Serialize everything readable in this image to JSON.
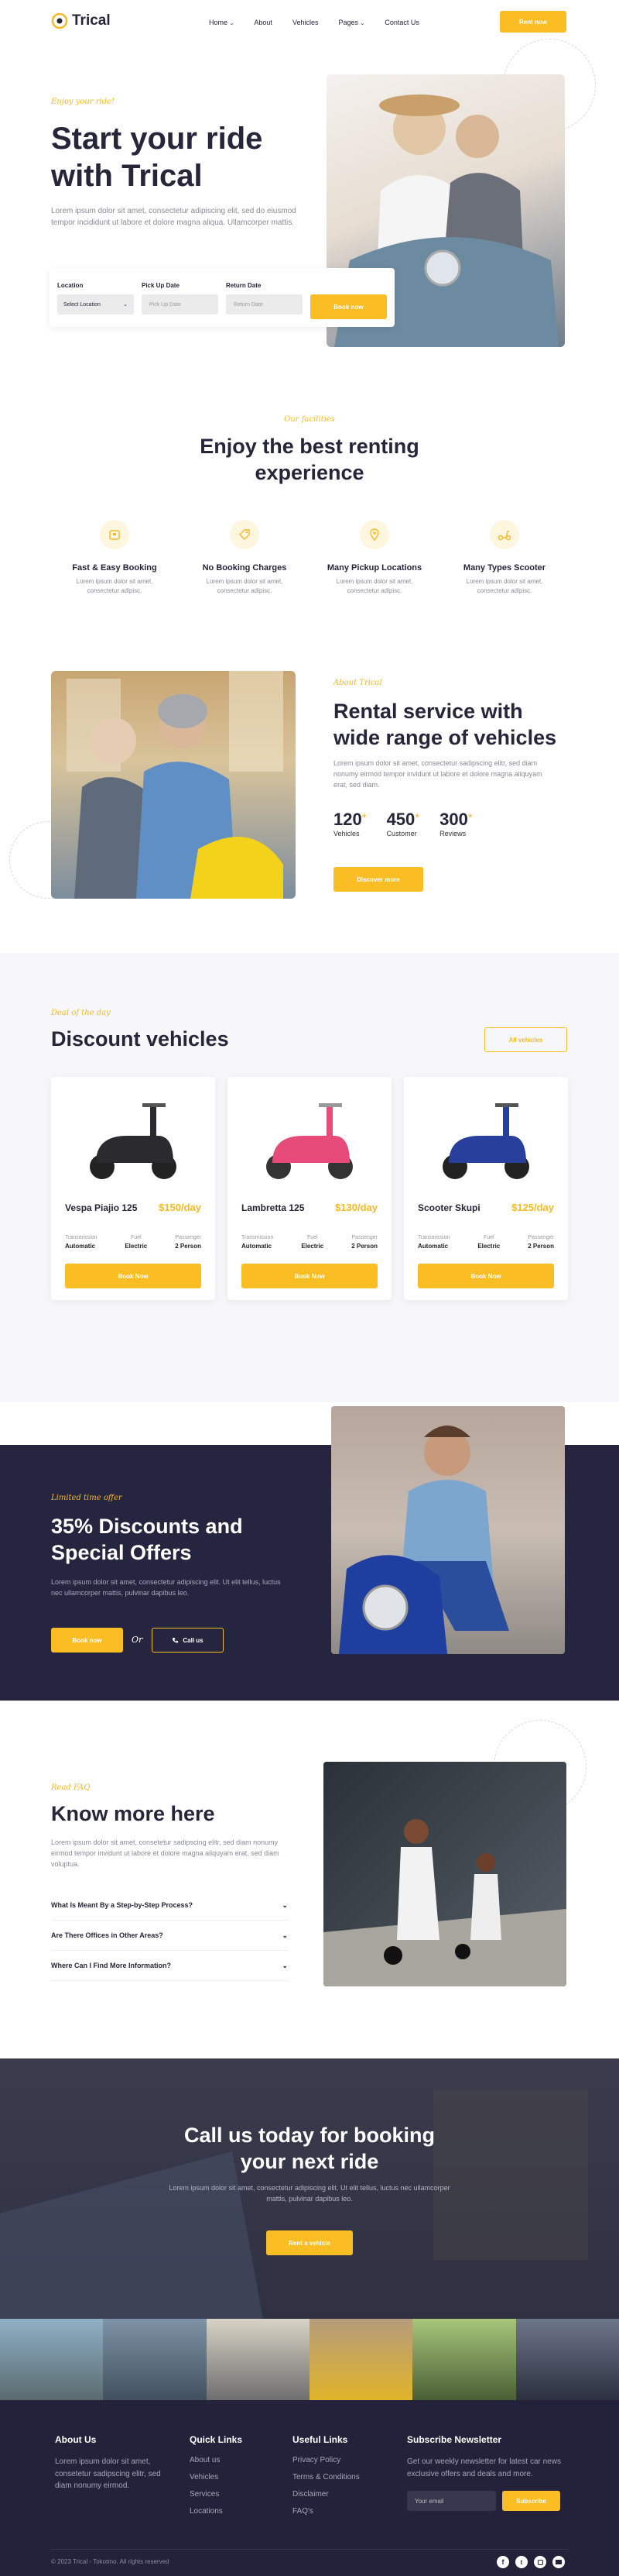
{
  "brand": {
    "name": "Trical"
  },
  "nav": {
    "items": [
      "Home",
      "About",
      "Vehicles",
      "Pages",
      "Contact Us"
    ],
    "cta": "Rent now"
  },
  "hero": {
    "kicker": "Enjoy your ride!",
    "title_line1": "Start your ride",
    "title_line2": "with Trical",
    "text": "Lorem ipsum dolor sit amet, consectetur adipiscing elit, sed do eiusmod tempor incididunt ut labore et dolore magna aliqua. Ullamcorper mattis.",
    "search": {
      "location_label": "Location",
      "location_value": "Select Location",
      "pickup_label": "Pick Up Date",
      "pickup_placeholder": "Pick Up Date",
      "return_label": "Return Date",
      "return_placeholder": "Return Date",
      "button": "Book now"
    }
  },
  "facilities": {
    "kicker": "Our facilities",
    "title_line1": "Enjoy the best renting",
    "title_line2": "experience",
    "items": [
      {
        "icon": "wallet-icon",
        "title": "Fast & Easy Booking",
        "text": "Lorem ipsum dolor sit amet, consectetur adipisc."
      },
      {
        "icon": "discount-tag-icon",
        "title": "No Booking Charges",
        "text": "Lorem ipsum dolor sit amet, consectetur adipisc."
      },
      {
        "icon": "map-pin-icon",
        "title": "Many Pickup Locations",
        "text": "Lorem ipsum dolor sit amet, consectetur adipisc."
      },
      {
        "icon": "scooter-icon",
        "title": "Many Types Scooter",
        "text": "Lorem ipsum dolor sit amet, consectetur adipisc."
      }
    ]
  },
  "about": {
    "kicker": "About Trical",
    "title_line1": "Rental service with",
    "title_line2": "wide range of vehicles",
    "text": "Lorem ipsum dolor sit amet, consectetur sadipscing elitr, sed diam nonumy eirmod tempor invidunt ut labore et dolore magna aliquyam erat, sed diam.",
    "stats": [
      {
        "value": "120",
        "plus": "+",
        "label": "Vehicles"
      },
      {
        "value": "450",
        "plus": "+",
        "label": "Customer"
      },
      {
        "value": "300",
        "plus": "+",
        "label": "Reviews"
      }
    ],
    "button": "Discover more"
  },
  "deals": {
    "kicker": "Deal of the day",
    "title": "Discount vehicles",
    "all_button": "All vehicles",
    "specs": [
      "Transmission",
      "Fuel",
      "Passenger"
    ],
    "book_label": "Book Now",
    "vehicles": [
      {
        "name": "Vespa Piajio 125",
        "price": "$150/day",
        "color": "#2b2b2f",
        "spec_values": [
          "Automatic",
          "Electric",
          "2 Person"
        ]
      },
      {
        "name": "Lambretta 125",
        "price": "$130/day",
        "color": "#e64b7a",
        "spec_values": [
          "Automatic",
          "Electric",
          "2 Person"
        ]
      },
      {
        "name": "Scooter Skupi",
        "price": "$125/day",
        "color": "#283f9c",
        "spec_values": [
          "Automatic",
          "Electric",
          "2 Person"
        ]
      }
    ]
  },
  "offer": {
    "kicker": "Limited time offer",
    "title_line1": "35% Discounts and",
    "title_line2": "Special Offers",
    "text": "Lorem ipsum dolor sit amet, consectetur adipiscing elit. Ut elit tellus, luctus nec ullamcorper mattis, pulvinar dapibus leo.",
    "book": "Book now",
    "or": "Or",
    "call": "Call us"
  },
  "faq": {
    "kicker": "Read FAQ",
    "title": "Know more here",
    "text": "Lorem ipsum dolor sit amet, consetetur sadipscing elitr, sed diam nonumy eirmod tempor invidunt ut labore et dolore magna aliquyam erat, sed diam voluptua.",
    "questions": [
      "What Is Meant By a Step-by-Step Process?",
      "Are There Offices in Other Areas?",
      "Where Can I Find More Information?"
    ]
  },
  "cta": {
    "title_line1": "Call us today for booking",
    "title_line2": "your next ride",
    "text": "Lorem ipsum dolor sit amet, consectetur adipiscing elit. Ut elit tellus, luctus nec ullamcorper mattis, pulvinar dapibus leo.",
    "button": "Rent a vehicle"
  },
  "footer": {
    "about_title": "About Us",
    "about_text": "Lorem ipsum dolor sit amet, consetetur sadipscing elitr, sed diam nonumy eirmod.",
    "quick_title": "Quick Links",
    "quick": [
      "About us",
      "Vehicles",
      "Services",
      "Locations"
    ],
    "useful_title": "Useful Links",
    "useful": [
      "Privacy Policy",
      "Terms & Conditions",
      "Disclaimer",
      "FAQ's"
    ],
    "news_title": "Subscribe Newsletter",
    "news_text": "Get our weekly newsletter for latest car news exclusive offers and deals and more.",
    "email_placeholder": "Your email",
    "subscribe": "Subscribe",
    "copyright": "© 2023 Trical - Tokotmo. All rights reserved"
  }
}
